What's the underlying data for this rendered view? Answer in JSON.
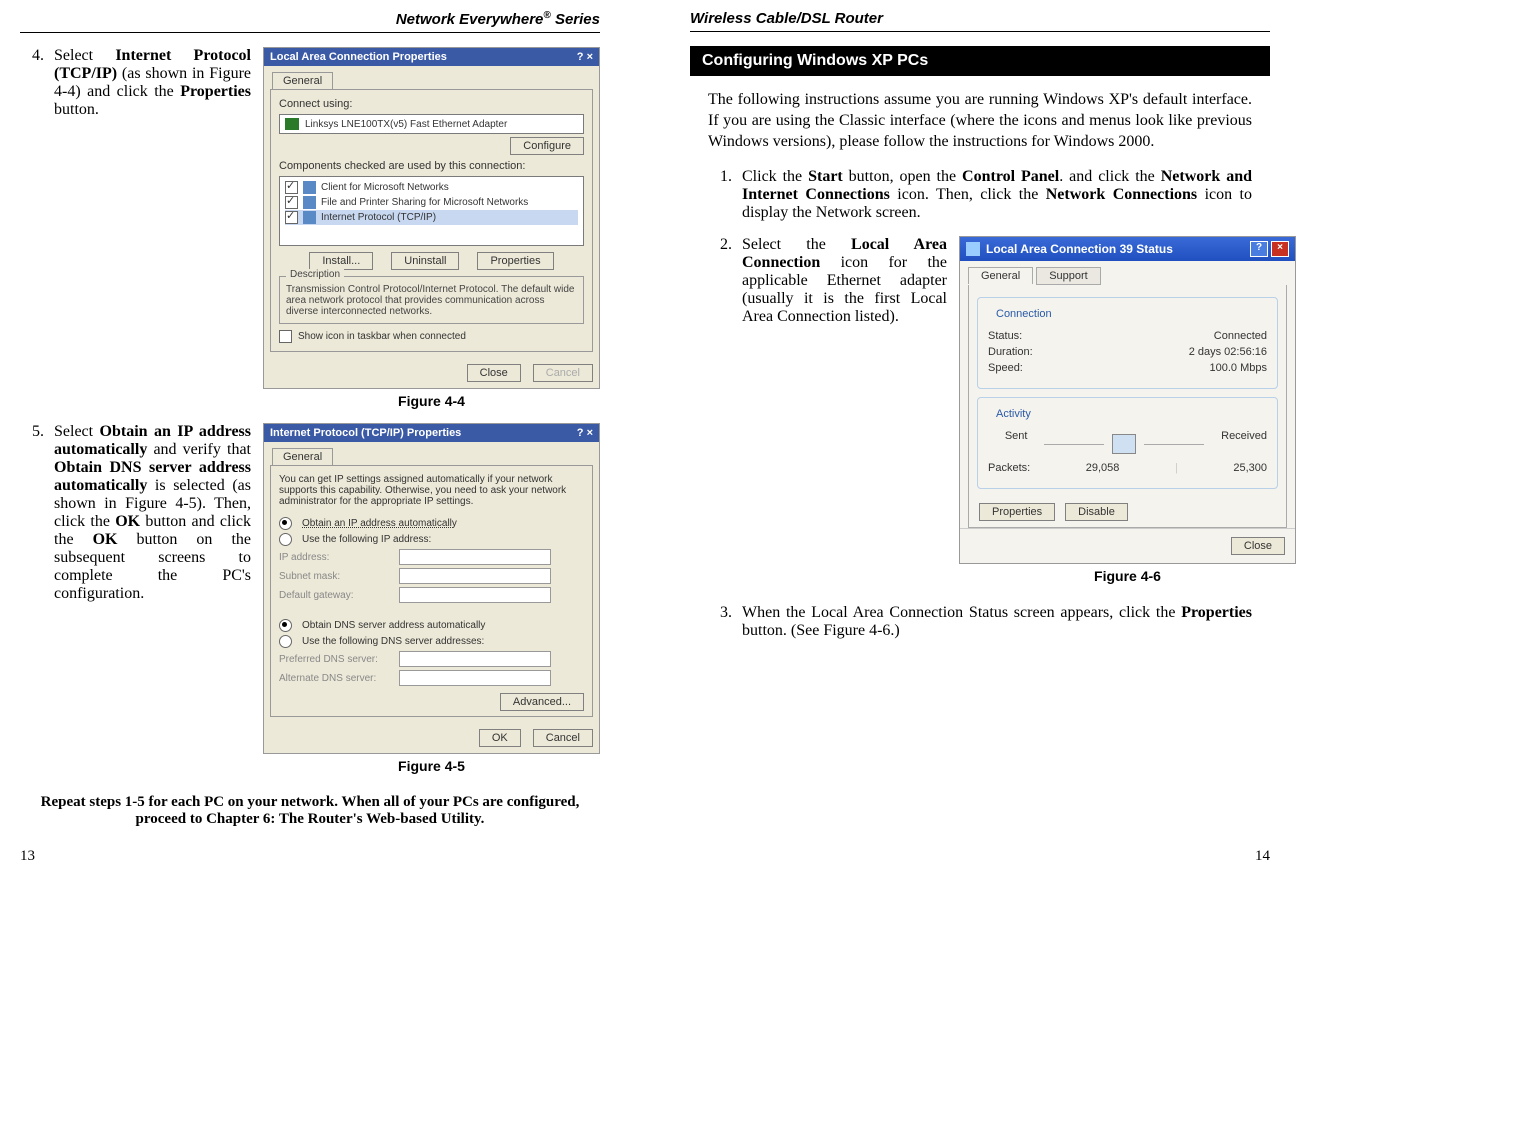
{
  "left": {
    "header": "Network Everywhere® Series",
    "step4": {
      "num": "4.",
      "text_before": "Select ",
      "b1": "Internet Protocol (TCP/IP)",
      "text_mid": " (as shown in Figure 4-4) and click the ",
      "b2": "Properties",
      "text_after": " button."
    },
    "step5": {
      "num": "5.",
      "t1": "Select ",
      "b1": "Obtain an IP address automatically",
      "t2": " and verify that ",
      "b2": "Obtain DNS server address automatically",
      "t3": " is selected (as shown in Figure 4-5). Then, click the ",
      "b3": "OK",
      "t4": " but­ton and click the ",
      "b4": "OK",
      "t5": " but­ton on the subsequent screens to complete the PC's configuration."
    },
    "fig44": {
      "title": "Local Area Connection Properties",
      "tab": "General",
      "connect_label": "Connect using:",
      "adapter": "Linksys LNE100TX(v5) Fast Ethernet Adapter",
      "configure": "Configure",
      "components_label": "Components checked are used by this connection:",
      "comp1": "Client for Microsoft Networks",
      "comp2": "File and Printer Sharing for Microsoft Networks",
      "comp3": "Internet Protocol (TCP/IP)",
      "install": "Install...",
      "uninstall": "Uninstall",
      "properties": "Properties",
      "desc_label": "Description",
      "desc": "Transmission Control Protocol/Internet Protocol. The default wide area network protocol that provides communication across diverse interconnected networks.",
      "showicon": "Show icon in taskbar when connected",
      "close": "Close",
      "cancel": "Cancel",
      "caption": "Figure 4-4"
    },
    "fig45": {
      "title": "Internet Protocol (TCP/IP) Properties",
      "tab": "General",
      "intro": "You can get IP settings assigned automatically if your network supports this capability. Otherwise, you need to ask your network administrator for the appropriate IP settings.",
      "r1": "Obtain an IP address automatically",
      "r2": "Use the following IP address:",
      "ip_label": "IP address:",
      "subnet_label": "Subnet mask:",
      "gw_label": "Default gateway:",
      "r3": "Obtain DNS server address automatically",
      "r4": "Use the following DNS server addresses:",
      "pdns": "Preferred DNS server:",
      "adns": "Alternate DNS server:",
      "advanced": "Advanced...",
      "ok": "OK",
      "cancel": "Cancel",
      "caption": "Figure 4-5"
    },
    "repeat": "Repeat steps 1-5 for each PC on your network.  When all of your PCs are configured, proceed to Chapter 6: The Router's Web-based Utility.",
    "pagenum": "13"
  },
  "right": {
    "header": "Wireless Cable/DSL Router",
    "section": "Configuring Windows XP PCs",
    "intro": "The following instructions assume you are running Windows XP's default interface. If you are using the Classic interface (where the icons and menus look like previous Windows versions), please follow the instructions for Windows 2000.",
    "step1": {
      "num": "1.",
      "t1": "Click the ",
      "b1": "Start",
      "t2": " button, open the ",
      "b2": "Control Panel",
      "t3": ". and click the ",
      "b3": "Network and Internet Connections",
      "t4": " icon. Then, click the ",
      "b4": "Network Connections",
      "t5": " icon to display the Network screen."
    },
    "step2": {
      "num": "2.",
      "t1": "Select the ",
      "b1": "Local Area Connection",
      "t2": " icon for the applicable Ethernet adapter (usually it is the first Local Area Connection listed)."
    },
    "step3": {
      "num": "3.",
      "t1": "When the Local Area Connection Status screen appears, click the ",
      "b1": "Properties",
      "t2": " button. (See Figure 4-6.)"
    },
    "fig46": {
      "title": "Local Area Connection 39 Status",
      "tab1": "General",
      "tab2": "Support",
      "g1": "Connection",
      "status_l": "Status:",
      "status_v": "Connected",
      "dur_l": "Duration:",
      "dur_v": "2 days 02:56:16",
      "spd_l": "Speed:",
      "spd_v": "100.0 Mbps",
      "g2": "Activity",
      "sent": "Sent",
      "recv": "Received",
      "pkts_l": "Packets:",
      "pkts_sent": "29,058",
      "pkts_recv": "25,300",
      "props": "Properties",
      "disable": "Disable",
      "close": "Close",
      "caption": "Figure 4-6"
    },
    "pagenum": "14"
  }
}
